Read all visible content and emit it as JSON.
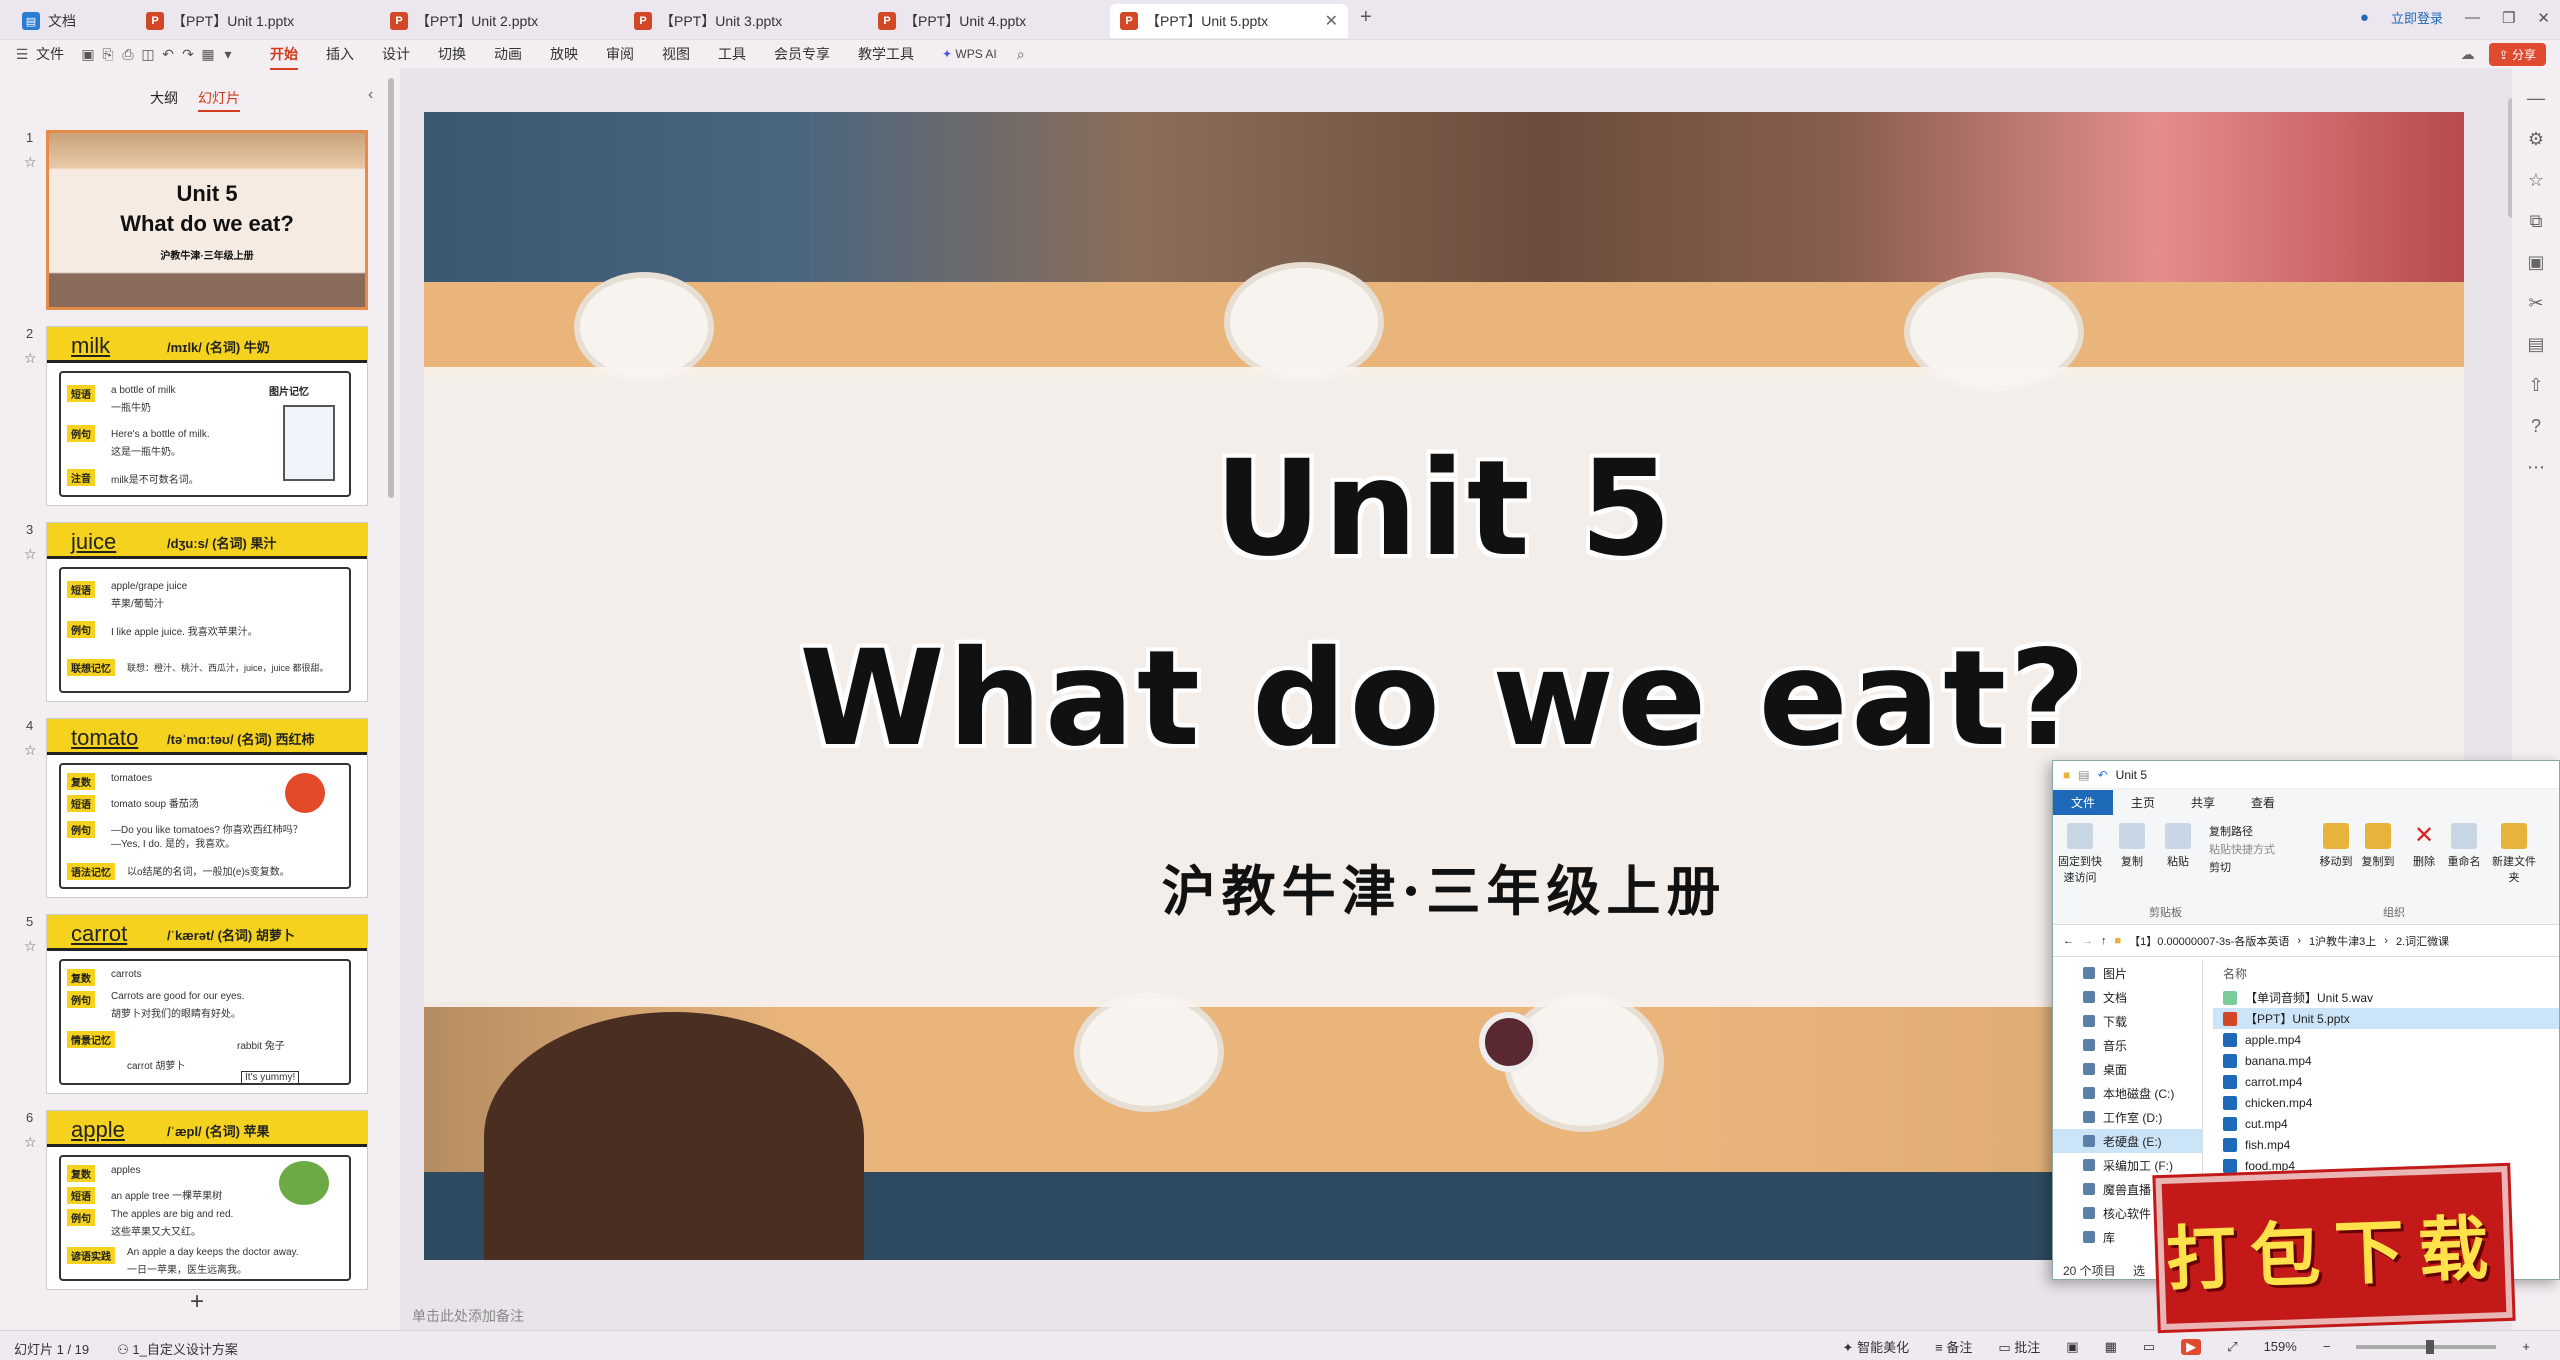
{
  "tabs": [
    {
      "label": "文档",
      "icon": "document-icon",
      "color": "#2b7cd3"
    },
    {
      "label": "【PPT】Unit 1.pptx",
      "icon": "ppt-icon",
      "color": "#d24726"
    },
    {
      "label": "【PPT】Unit 2.pptx",
      "icon": "ppt-icon",
      "color": "#d24726"
    },
    {
      "label": "【PPT】Unit 3.pptx",
      "icon": "ppt-icon",
      "color": "#d24726"
    },
    {
      "label": "【PPT】Unit 4.pptx",
      "icon": "ppt-icon",
      "color": "#d24726"
    },
    {
      "label": "【PPT】Unit 5.pptx",
      "icon": "ppt-icon",
      "color": "#d24726",
      "active": true
    }
  ],
  "login_label": "立即登录",
  "share_label": "分享",
  "menu": {
    "file": "文件",
    "items": [
      "开始",
      "插入",
      "设计",
      "切换",
      "动画",
      "放映",
      "审阅",
      "视图",
      "工具",
      "会员专享",
      "教学工具"
    ],
    "active": "开始",
    "wps_ai": "WPS AI"
  },
  "panel": {
    "tab_outline": "大纲",
    "tab_slides": "幻灯片"
  },
  "thumbnails": [
    {
      "num": "1",
      "title1": "Unit 5",
      "title2": "What do we eat?",
      "sub": "沪教牛津·三年级上册"
    },
    {
      "num": "2",
      "word": "milk",
      "ipa": "/mɪlk/ (名词) 牛奶",
      "lines": [
        "a bottle of milk",
        "一瓶牛奶",
        "Here's a bottle of milk.",
        "这是一瓶牛奶。",
        "milk是不可数名词。"
      ],
      "labels": [
        "短语",
        "例句",
        "注音"
      ],
      "tag": "图片记忆"
    },
    {
      "num": "3",
      "word": "juice",
      "ipa": "/dʒuːs/ (名词) 果汁",
      "lines": [
        "apple/grape juice",
        "苹果/葡萄汁",
        "I like apple juice. 我喜欢苹果汁。",
        "联想：橙汁、桃汁、西瓜汁，juice，juice 都很甜。"
      ],
      "labels": [
        "短语",
        "例句",
        "联想记忆"
      ]
    },
    {
      "num": "4",
      "word": "tomato",
      "ipa": "/təˈmɑːtəʊ/ (名词) 西红柿",
      "lines": [
        "tomatoes",
        "tomato soup  番茄汤",
        "—Do you like tomatoes? 你喜欢西红柿吗？",
        "—Yes, I do.  是的，我喜欢。",
        "以o结尾的名词，一般加(e)s变复数。"
      ],
      "labels": [
        "复数",
        "短语",
        "例句",
        "语法记忆"
      ]
    },
    {
      "num": "5",
      "word": "carrot",
      "ipa": "/ˈkærət/ (名词) 胡萝卜",
      "lines": [
        "carrots",
        "Carrots are good for our eyes.",
        "胡萝卜对我们的眼睛有好处。",
        "rabbit 兔子",
        "carrot 胡萝卜",
        "It's yummy!"
      ],
      "labels": [
        "复数",
        "例句",
        "情景记忆"
      ]
    },
    {
      "num": "6",
      "word": "apple",
      "ipa": "/ˈæpl/ (名词) 苹果",
      "lines": [
        "apples",
        "an apple tree  一棵苹果树",
        "The apples are big and red.",
        "这些苹果又大又红。",
        "An apple a day keeps the doctor away.",
        "一日一苹果，医生远离我。"
      ],
      "labels": [
        "复数",
        "短语",
        "例句",
        "谚语实践"
      ]
    }
  ],
  "slide": {
    "title_line1": "Unit 5",
    "title_line2": "What do we eat?",
    "subtitle": "沪教牛津·三年级上册"
  },
  "notes_placeholder": "单击此处添加备注",
  "status": {
    "slide_counter": "幻灯片 1 / 19",
    "theme": "1_自定义设计方案",
    "beautify": "智能美化",
    "notes": "备注",
    "comments": "批注",
    "zoom": "159%"
  },
  "explorer": {
    "title": "Unit 5",
    "ribbon_tabs": [
      "文件",
      "主页",
      "共享",
      "查看"
    ],
    "buttons": [
      "固定到快速访问",
      "复制",
      "粘贴",
      "复制路径",
      "粘贴快捷方式",
      "剪切",
      "移动到",
      "复制到",
      "删除",
      "重命名",
      "新建文件夹"
    ],
    "groups": [
      "剪贴板",
      "组织"
    ],
    "address": [
      "【1】0.00000007-3s-各版本英语",
      "1沪教牛津3上",
      "2.词汇微课"
    ],
    "nav": [
      "图片",
      "文档",
      "下载",
      "音乐",
      "桌面",
      "本地磁盘 (C:)",
      "工作室 (D:)",
      "老硬盘 (E:)",
      "采编加工 (F:)",
      "魔兽直播 (G:)",
      "核心软件",
      "库"
    ],
    "nav_selected": "老硬盘 (E:)",
    "col_name": "名称",
    "files": [
      "【单词音频】Unit 5.wav",
      "【PPT】Unit 5.pptx",
      "apple.mp4",
      "banana.mp4",
      "carrot.mp4",
      "chicken.mp4",
      "cut.mp4",
      "fish.mp4",
      "food.mp4"
    ],
    "selected_file": "【PPT】Unit 5.pptx",
    "count": "20 个项目",
    "sel_prefix": "选"
  },
  "stamp": "打包下载"
}
